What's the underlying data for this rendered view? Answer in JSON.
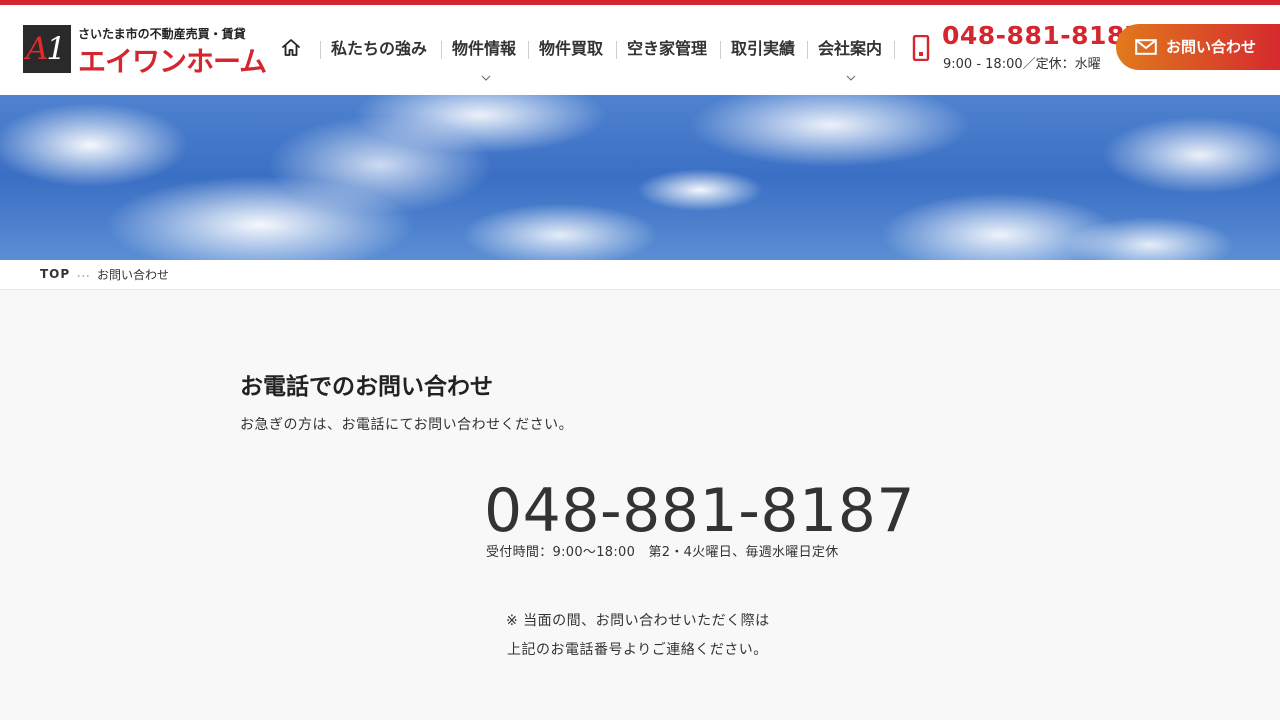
{
  "header": {
    "logo_mark": "A1",
    "logo_tagline": "さいたま市の不動産売買・賃貸",
    "logo_name": "エイワンホーム",
    "nav": [
      "私たちの強み",
      "物件情報",
      "物件買取",
      "空き家管理",
      "取引実績",
      "会社案内"
    ],
    "phone_number": "048-881-8187",
    "phone_hours": "9:00 - 18:00／定休：水曜",
    "contact_label": "お問い合わせ"
  },
  "breadcrumb": {
    "top": "TOP",
    "separator": "･･･",
    "current": "お問い合わせ"
  },
  "main": {
    "title": "お電話でのお問い合わせ",
    "lead": "お急ぎの方は、お電話にてお問い合わせください。",
    "phone_number": "048-881-8187",
    "reception": "受付時間：9:00～18:00　第2・4火曜日、毎週水曜日定休",
    "note_line1": "※ 当面の間、お問い合わせいただく際は",
    "note_line2": "上記のお電話番号よりご連絡ください。"
  },
  "colors": {
    "accent": "#d5262f",
    "button_gradient_start": "#e07a1c",
    "button_gradient_end": "#d5262f",
    "page_bg": "#f8f8f8"
  },
  "icons": {
    "home": "home-icon",
    "phone": "mobile-phone-icon",
    "mail": "mail-icon",
    "chevron": "chevron-down-icon"
  }
}
